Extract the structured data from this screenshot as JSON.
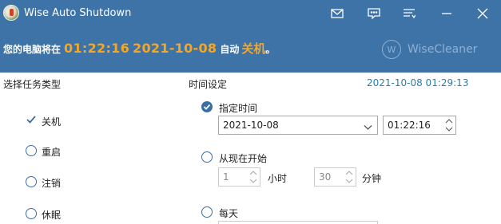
{
  "window": {
    "title": "Wise Auto Shutdown",
    "controls": [
      "mail-icon",
      "feedback-icon",
      "menu-icon",
      "minimize-icon",
      "close-icon"
    ]
  },
  "status": {
    "prefix": "您的电脑将在",
    "time": "01:22:16",
    "date": "2021-10-08",
    "middle": "自动",
    "action": "关机",
    "suffix": "。"
  },
  "brand": {
    "logo": "W",
    "name": "WiseCleaner"
  },
  "task_type": {
    "label": "选择任务类型",
    "options": [
      {
        "label": "关机",
        "selected": true
      },
      {
        "label": "重启",
        "selected": false
      },
      {
        "label": "注销",
        "selected": false
      },
      {
        "label": "休眠",
        "selected": false
      }
    ]
  },
  "time_settings": {
    "label": "时间设定",
    "current_datetime": "2021-10-08 01:29:13",
    "specified": {
      "label": "指定时间",
      "selected": true,
      "date_value": "2021-10-08",
      "time_value": "01:22:16"
    },
    "from_now": {
      "label": "从现在开始",
      "selected": false,
      "hours_value": "1",
      "hours_unit": "小时",
      "minutes_value": "30",
      "minutes_unit": "分钟"
    },
    "daily": {
      "label": "每天",
      "selected": false
    }
  },
  "colors": {
    "header_bg": "#3e73a8",
    "accent_orange": "#f5a623",
    "datetime_teal": "#2b7fa6",
    "radio_blue": "#3a6fa6"
  }
}
